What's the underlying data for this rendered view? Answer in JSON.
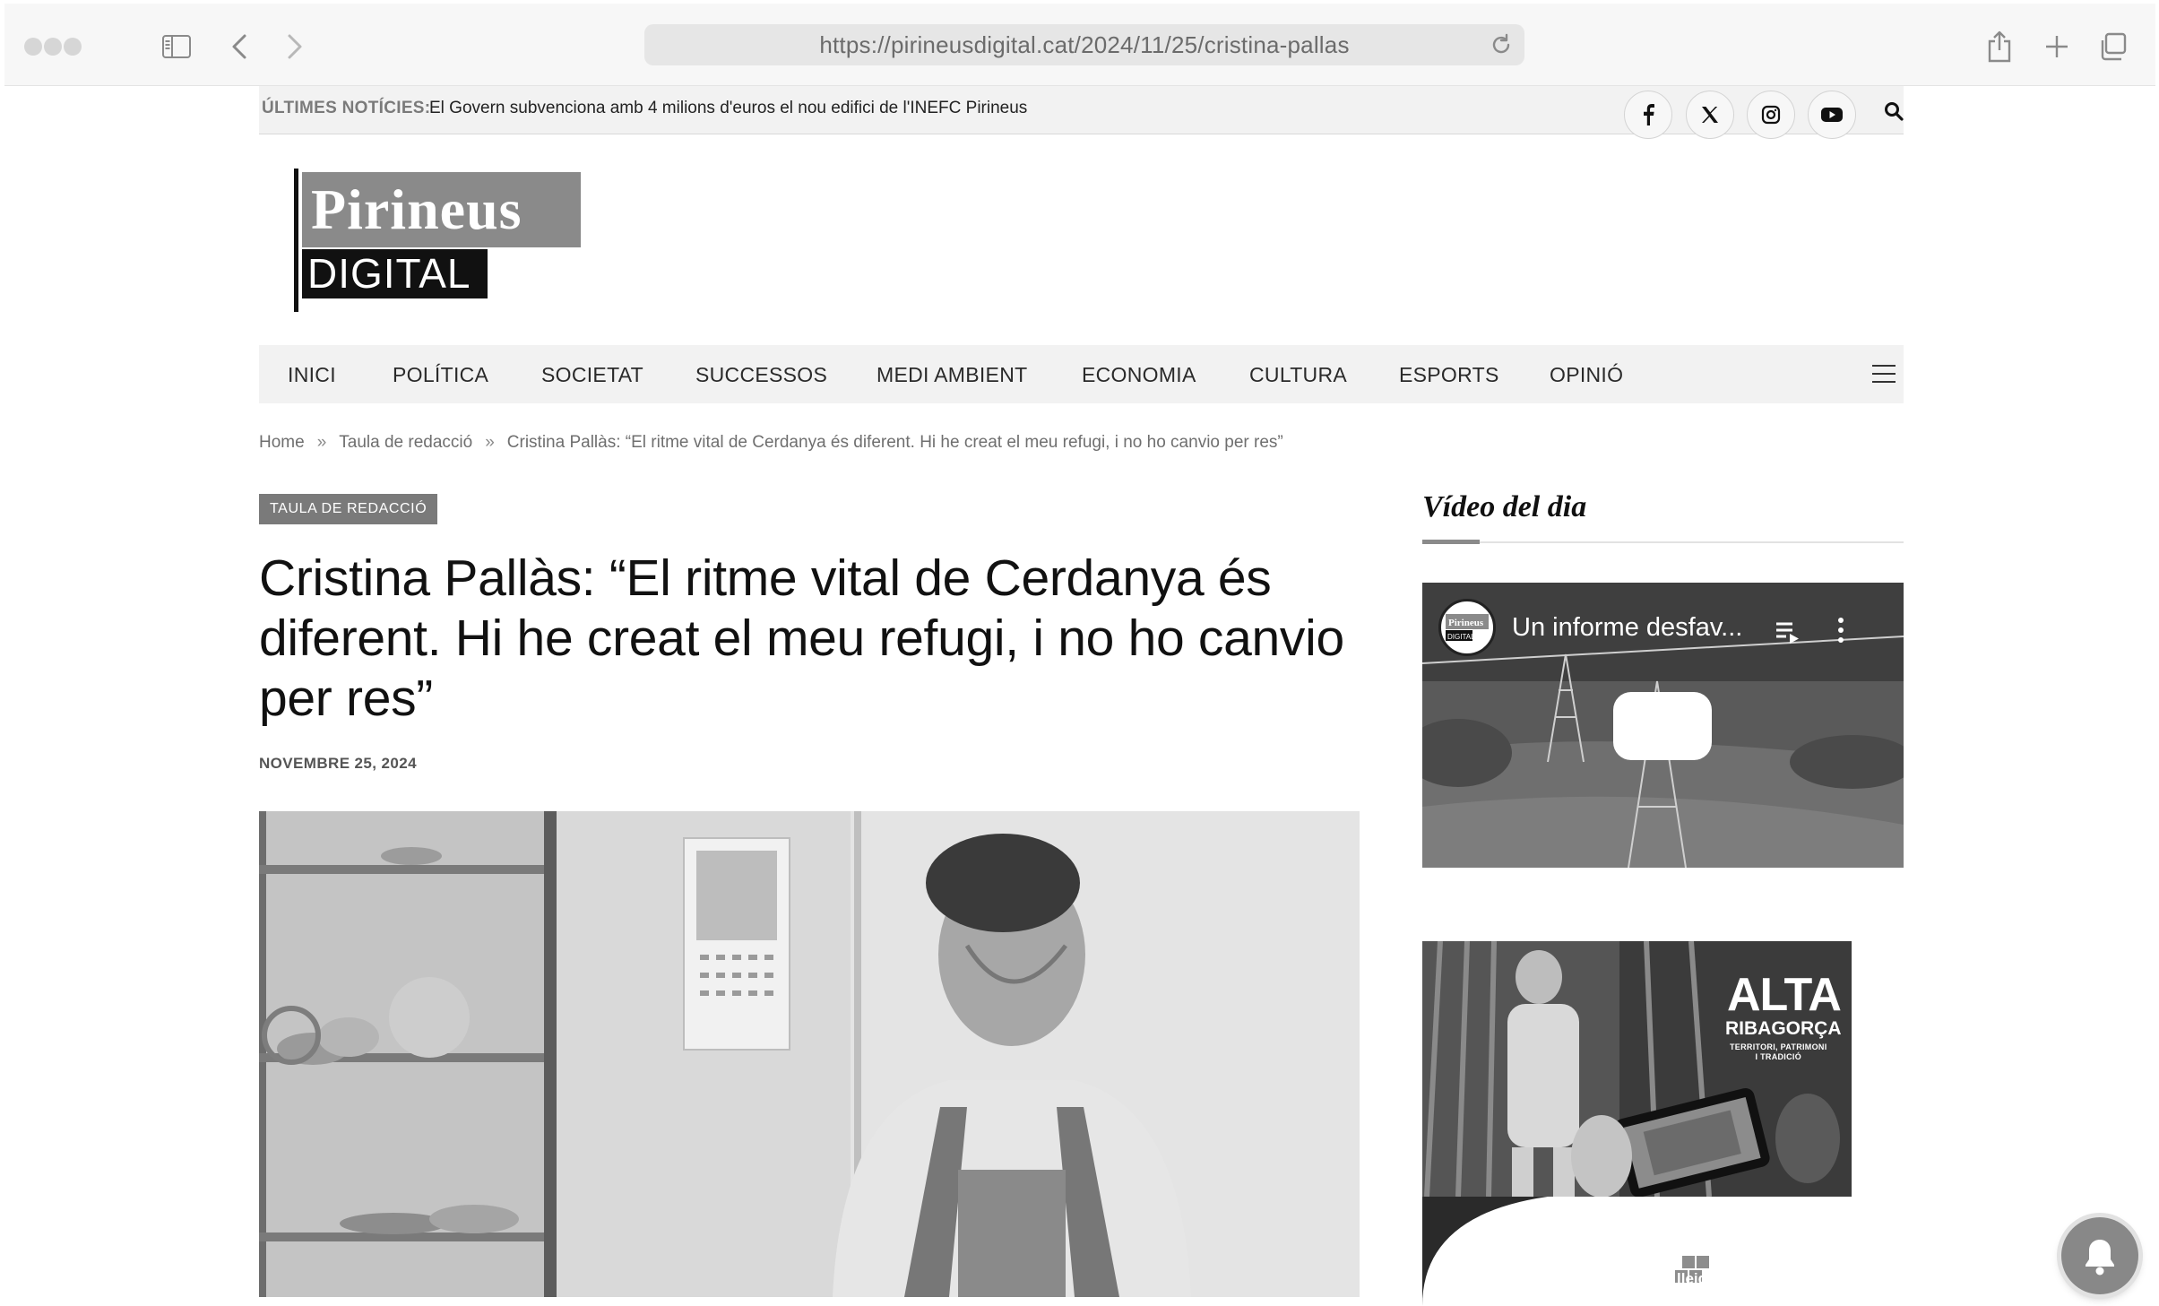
{
  "browser": {
    "url": "https://pirineusdigital.cat/2024/11/25/cristina-pallas"
  },
  "ticker": {
    "label": "ÚLTIMES NOTÍCIES:",
    "text": "El Govern subvenciona amb 4 milions d'euros el nou edifici de l'INEFC Pirineus"
  },
  "logo": {
    "top": "Pirineus",
    "bottom": "DIGITAL"
  },
  "nav": {
    "items": [
      "INICI",
      "POLÍTICA",
      "SOCIETAT",
      "SUCCESSOS",
      "MEDI AMBIENT",
      "ECONOMIA",
      "CULTURA",
      "ESPORTS",
      "OPINIÓ"
    ]
  },
  "breadcrumb": {
    "home": "Home",
    "sep": "»",
    "section": "Taula de redacció",
    "current": "Cristina Pallàs: “El ritme vital de Cerdanya és diferent. Hi he creat el meu refugi, i no ho canvio per res”"
  },
  "article": {
    "category": "TAULA DE REDACCIÓ",
    "title": "Cristina Pallàs: “El ritme vital de Cerdanya és diferent. Hi he creat el meu refugi, i no ho canvio per res”",
    "date": "NOVEMBRE 25, 2024"
  },
  "sidebar": {
    "heading": "Vídeo del dia",
    "video_title": "Un informe desfav...",
    "channel_logo_top": "Pirineus",
    "channel_logo_bottom": "DIGITAL"
  },
  "ad": {
    "title": "ALTA",
    "subtitle": "RIBAGORÇA",
    "tagline_1": "TERRITORI, PATRIMONI",
    "tagline_2": "I TRADICIÓ",
    "logo_text": "lleida"
  },
  "icons": {
    "sidebar": "sidebar-icon",
    "back": "chevron-left-icon",
    "forward": "chevron-right-icon",
    "reload": "reload-icon",
    "share": "share-icon",
    "new_tab": "plus-icon",
    "tabs": "tabs-icon",
    "facebook": "facebook-icon",
    "x": "x-icon",
    "instagram": "instagram-icon",
    "youtube": "youtube-icon",
    "search": "search-icon",
    "menu": "hamburger-icon",
    "notification": "bell-icon"
  }
}
